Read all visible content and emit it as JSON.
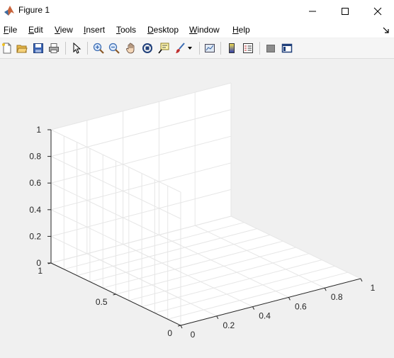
{
  "window": {
    "title": "Figure 1",
    "app_icon": "matlab-icon",
    "controls": [
      "minimize-icon",
      "maximize-icon",
      "close-icon"
    ]
  },
  "menubar": {
    "items": [
      {
        "label": "File",
        "mnemonic": "F",
        "rest": "ile"
      },
      {
        "label": "Edit",
        "mnemonic": "E",
        "rest": "dit"
      },
      {
        "label": "View",
        "mnemonic": "V",
        "rest": "iew"
      },
      {
        "label": "Insert",
        "mnemonic": "I",
        "rest": "nsert"
      },
      {
        "label": "Tools",
        "mnemonic": "T",
        "rest": "ools"
      },
      {
        "label": "Desktop",
        "mnemonic": "D",
        "rest": "esktop"
      },
      {
        "label": "Window",
        "mnemonic": "W",
        "rest": "indow"
      },
      {
        "label": "Help",
        "mnemonic": "H",
        "rest": "elp"
      }
    ],
    "dock_icon": "dock-arrow-icon"
  },
  "toolbar": {
    "buttons": [
      "new-figure-icon",
      "open-file-icon",
      "save-icon",
      "print-icon",
      "edit-plot-icon",
      "zoom-in-icon",
      "zoom-out-icon",
      "pan-icon",
      "rotate-3d-icon",
      "data-cursor-icon",
      "brush-icon",
      "link-plot-icon",
      "insert-colorbar-icon",
      "insert-legend-icon",
      "hide-plot-tools-icon",
      "show-plot-tools-icon"
    ]
  },
  "axes": {
    "z_ticks": [
      "0",
      "0.2",
      "0.4",
      "0.6",
      "0.8",
      "1"
    ],
    "x_ticks": [
      "0",
      "0.2",
      "0.4",
      "0.6",
      "0.8",
      "1"
    ],
    "y_ticks": [
      "0",
      "0.5",
      "1"
    ],
    "xlim": [
      0,
      1
    ],
    "ylim": [
      0,
      1
    ],
    "zlim": [
      0,
      1
    ],
    "grid": true,
    "box": false,
    "background_color": "#ffffff",
    "grid_color": "#e6e6e6",
    "axis_color": "#262626"
  }
}
